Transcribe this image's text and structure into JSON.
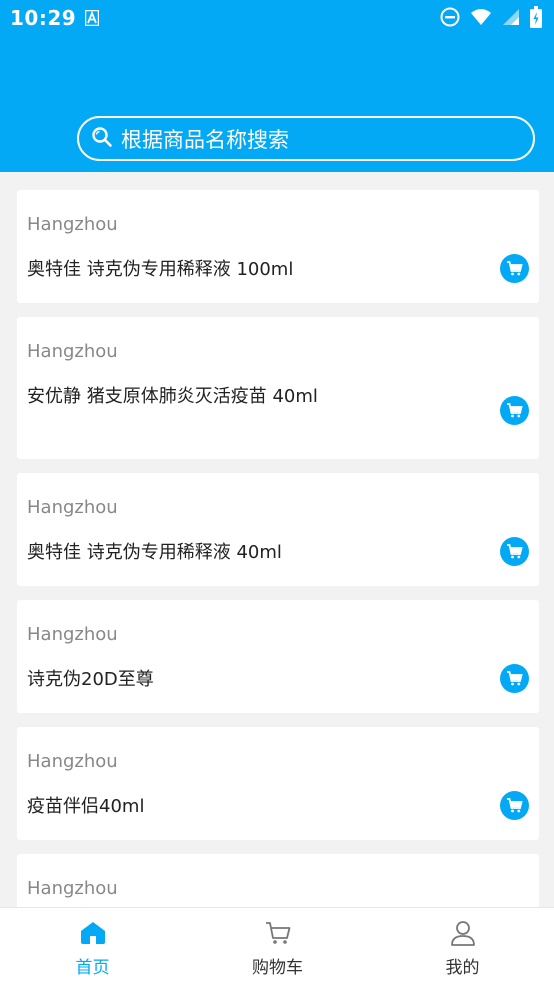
{
  "status": {
    "time": "10:29"
  },
  "search": {
    "placeholder": "根据商品名称搜索"
  },
  "products": [
    {
      "city": "Hangzhou",
      "name": "奥特佳 诗克伪专用稀释液 100ml"
    },
    {
      "city": "Hangzhou",
      "name": "安优静 猪支原体肺炎灭活疫苗 40ml"
    },
    {
      "city": "Hangzhou",
      "name": "奥特佳 诗克伪专用稀释液 40ml"
    },
    {
      "city": "Hangzhou",
      "name": "诗克伪20D至尊"
    },
    {
      "city": "Hangzhou",
      "name": "疫苗伴侣40ml"
    },
    {
      "city": "Hangzhou",
      "name": ""
    }
  ],
  "tabs": [
    {
      "label": "首页",
      "icon": "home-icon",
      "active": true
    },
    {
      "label": "购物车",
      "icon": "cart-icon",
      "active": false
    },
    {
      "label": "我的",
      "icon": "user-icon",
      "active": false
    }
  ],
  "colors": {
    "primary": "#03a9f4",
    "background": "#f2f2f2"
  }
}
